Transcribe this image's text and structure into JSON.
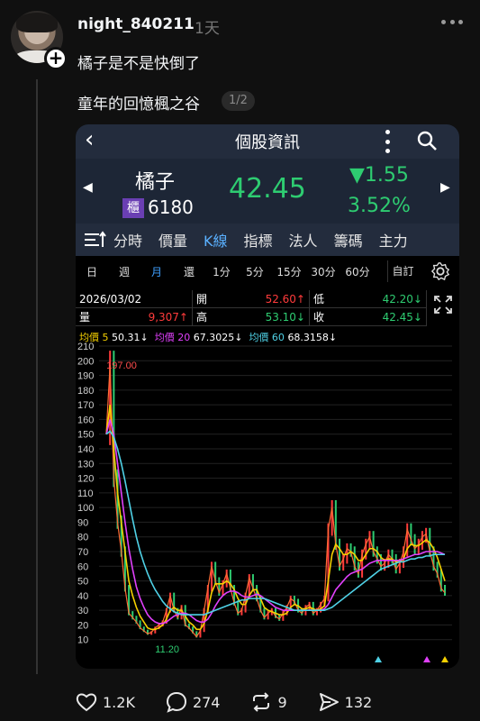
{
  "post": {
    "username": "night_840211",
    "time": "1天",
    "text": "橘子是不是快倒了",
    "album_title": "童年的回憶楓之谷",
    "page_indicator": "1/2"
  },
  "app": {
    "title": "個股資訊",
    "stock": {
      "name": "橘子",
      "market_badge": "櫃",
      "code": "6180",
      "price": "42.45",
      "change": "▼1.55",
      "change_pct": "3.52%"
    },
    "tabs": [
      "分時",
      "價量",
      "K線",
      "指標",
      "法人",
      "籌碼",
      "主力"
    ],
    "active_tab": "K線",
    "periods": [
      "日",
      "週",
      "月",
      "還",
      "1分",
      "5分",
      "15分",
      "30分",
      "60分"
    ],
    "active_period": "月",
    "custom_label": "自訂",
    "quote": {
      "date": "2026/03/02",
      "open_label": "開",
      "open": "52.60↑",
      "low_label": "低",
      "low": "42.20↓",
      "volume_label": "量",
      "volume": "9,307↑",
      "high_label": "高",
      "high": "53.10↓",
      "close_label": "收",
      "close": "42.45↓"
    },
    "ma": {
      "ma5_label": "均價 5",
      "ma5": "50.31↓",
      "ma20_label": "均價 20",
      "ma20": "67.3025↓",
      "ma60_label": "均價 60",
      "ma60": "68.3158↓"
    }
  },
  "colors": {
    "up": "#ff3b3b",
    "down": "#2ecc71",
    "ma5": "#f5d000",
    "ma20": "#e040fb",
    "ma60": "#4fd1e6",
    "accent": "#5ab0ff"
  },
  "chart_data": {
    "type": "line",
    "ylim": [
      0,
      210
    ],
    "y_ticks": [
      "210",
      "200",
      "190",
      "180",
      "170",
      "160",
      "150",
      "140",
      "130",
      "120",
      "110",
      "100",
      "90",
      "80",
      "70",
      "60",
      "50",
      "40",
      "30",
      "20",
      "10"
    ],
    "annotations": [
      {
        "text": "197.00",
        "value": 197
      },
      {
        "text": "11.20",
        "value": 11.2
      }
    ],
    "series": [
      {
        "values": [
          150,
          197,
          120,
          90,
          70,
          45,
          28,
          25,
          22,
          18,
          16,
          14,
          15,
          18,
          20,
          22,
          30,
          40,
          30,
          25,
          32,
          20,
          18,
          15,
          12,
          16,
          30,
          45,
          60,
          50,
          42,
          48,
          55,
          45,
          35,
          28,
          30,
          40,
          52,
          45,
          38,
          30,
          25,
          28,
          30,
          26,
          24,
          28,
          32,
          38,
          36,
          30,
          28,
          32,
          34,
          28,
          30,
          34,
          38,
          85,
          100,
          75,
          60,
          65,
          72,
          70,
          60,
          55,
          68,
          75,
          80,
          70,
          65,
          60,
          62,
          68,
          65,
          58,
          62,
          70,
          85,
          78,
          72,
          75,
          80,
          82,
          70,
          60,
          55,
          45,
          42
        ]
      },
      {
        "values": [
          150,
          170,
          140,
          110,
          90,
          70,
          50,
          40,
          32,
          26,
          22,
          18,
          17,
          17,
          18,
          20,
          24,
          30,
          32,
          30,
          30,
          26,
          22,
          20,
          17,
          17,
          21,
          30,
          42,
          48,
          48,
          48,
          50,
          48,
          44,
          38,
          34,
          34,
          40,
          44,
          44,
          38,
          32,
          30,
          29,
          28,
          27,
          27,
          28,
          32,
          34,
          33,
          31,
          31,
          32,
          31,
          30,
          31,
          33,
          50,
          68,
          75,
          72,
          68,
          68,
          70,
          68,
          64,
          64,
          68,
          72,
          72,
          70,
          66,
          64,
          65,
          65,
          63,
          63,
          65,
          72,
          75,
          74,
          74,
          76,
          78,
          76,
          72,
          66,
          58,
          50
        ]
      },
      {
        "values": [
          150,
          160,
          150,
          130,
          110,
          90,
          72,
          58,
          46,
          38,
          32,
          27,
          24,
          22,
          21,
          21,
          22,
          24,
          26,
          27,
          28,
          28,
          27,
          25,
          23,
          22,
          22,
          24,
          28,
          33,
          37,
          40,
          42,
          43,
          43,
          42,
          40,
          39,
          39,
          40,
          41,
          40,
          38,
          36,
          34,
          32,
          31,
          30,
          30,
          30,
          30,
          30,
          30,
          30,
          30,
          30,
          30,
          30,
          31,
          34,
          39,
          44,
          47,
          50,
          53,
          55,
          56,
          57,
          58,
          60,
          62,
          63,
          64,
          64,
          64,
          64,
          64,
          64,
          64,
          65,
          66,
          67,
          68,
          68,
          69,
          70,
          70,
          70,
          70,
          69,
          68
        ]
      },
      {
        "values": [
          150,
          152,
          148,
          140,
          130,
          118,
          105,
          92,
          80,
          70,
          62,
          55,
          49,
          44,
          40,
          36,
          33,
          31,
          29,
          28,
          27,
          27,
          27,
          27,
          27,
          27,
          27,
          28,
          29,
          30,
          31,
          32,
          33,
          34,
          35,
          36,
          37,
          37,
          38,
          38,
          38,
          38,
          38,
          37,
          36,
          35,
          34,
          33,
          32,
          31,
          30,
          30,
          30,
          30,
          30,
          30,
          30,
          30,
          30,
          31,
          32,
          34,
          36,
          38,
          40,
          42,
          44,
          46,
          48,
          50,
          52,
          54,
          56,
          58,
          59,
          60,
          61,
          62,
          63,
          63,
          64,
          65,
          65,
          66,
          66,
          67,
          67,
          68,
          68,
          68,
          68
        ]
      }
    ]
  }
}
